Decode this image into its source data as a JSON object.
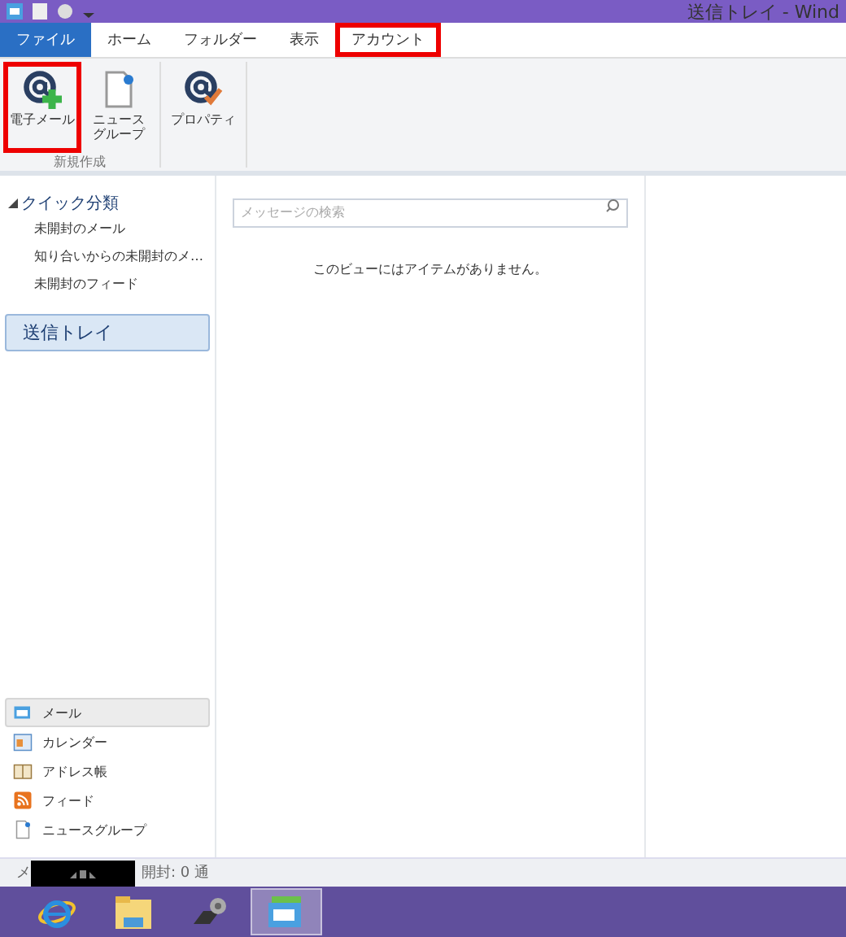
{
  "window": {
    "title": "送信トレイ - Wind"
  },
  "tabs": [
    {
      "label": "ファイル",
      "selected": true,
      "highlighted": false
    },
    {
      "label": "ホーム",
      "selected": false,
      "highlighted": false
    },
    {
      "label": "フォルダー",
      "selected": false,
      "highlighted": false
    },
    {
      "label": "表示",
      "selected": false,
      "highlighted": false
    },
    {
      "label": "アカウント",
      "selected": false,
      "highlighted": true
    }
  ],
  "ribbon": {
    "groups": [
      {
        "label": "新規作成",
        "buttons": [
          {
            "kind": "mail",
            "label": "電子メール",
            "highlighted": true
          },
          {
            "kind": "news",
            "label": "ニュースグループ",
            "highlighted": false
          }
        ]
      },
      {
        "buttons": [
          {
            "kind": "props",
            "label": "プロパティ",
            "highlighted": false
          }
        ]
      }
    ]
  },
  "sidebar": {
    "section": {
      "label": "クイック分類",
      "expanded": true,
      "items": [
        "未開封のメール",
        "知り合いからの未開封のメ…",
        "未開封のフィード"
      ]
    },
    "folders": [
      {
        "label": "送信トレイ",
        "selected": true
      }
    ],
    "nav": [
      {
        "kind": "mail",
        "label": "メール",
        "selected": true
      },
      {
        "kind": "calendar",
        "label": "カレンダー",
        "selected": false
      },
      {
        "kind": "contacts",
        "label": "アドレス帳",
        "selected": false
      },
      {
        "kind": "feed",
        "label": "フィード",
        "selected": false
      },
      {
        "kind": "news",
        "label": "ニュースグループ",
        "selected": false
      }
    ]
  },
  "search": {
    "placeholder": "メッセージの検索"
  },
  "message_list": {
    "empty_text": "このビューにはアイテムがありません。"
  },
  "status_bar": {
    "left": "メ",
    "right": "開封: 0 通"
  },
  "taskbar": [
    {
      "kind": "browser",
      "selected": false
    },
    {
      "kind": "folder",
      "selected": false
    },
    {
      "kind": "laptop",
      "selected": false
    },
    {
      "kind": "mail",
      "selected": true
    }
  ]
}
